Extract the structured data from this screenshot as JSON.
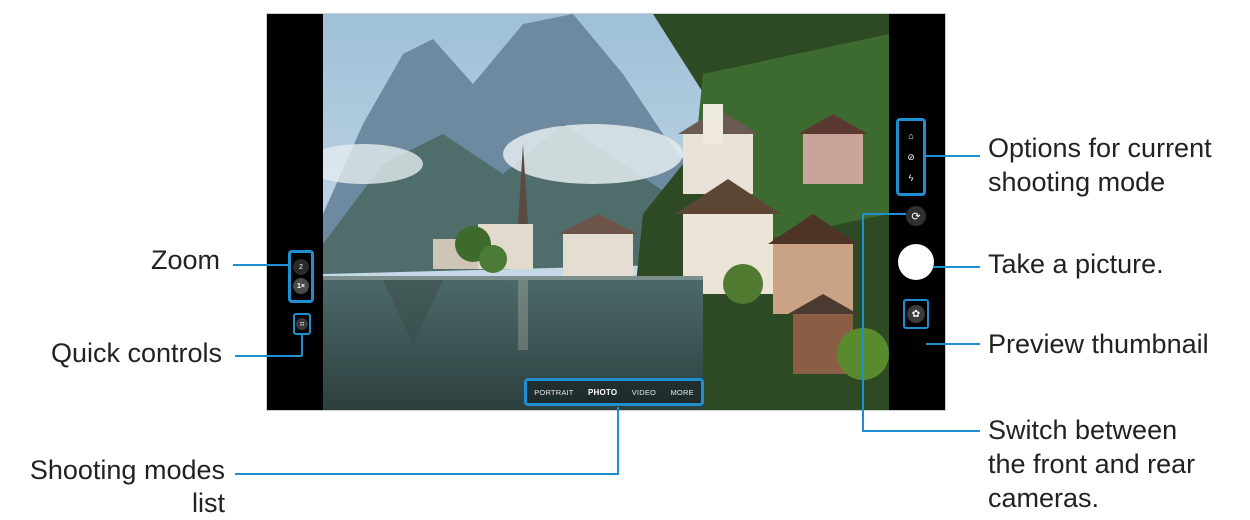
{
  "camera": {
    "zoom_levels": [
      "2",
      "1×"
    ],
    "active_zoom": "1×",
    "quick_controls_icon": "grid-dots-icon",
    "option_icons": [
      "camera-aspect-icon",
      "timer-off-icon",
      "flash-icon"
    ],
    "switch_icon": "rotate-camera-icon",
    "preview_icon": "flower-thumbnail-icon",
    "modes": [
      "PORTRAIT",
      "PHOTO",
      "VIDEO",
      "MORE"
    ],
    "active_mode": "PHOTO",
    "accent_color": "#1e8fd0"
  },
  "labels": {
    "zoom": "Zoom",
    "quick_controls": "Quick controls",
    "shooting_modes_line1": "Shooting modes",
    "shooting_modes_line2": "list",
    "options_line1": "Options for current",
    "options_line2": "shooting mode",
    "take_picture": "Take a picture.",
    "preview": "Preview thumbnail",
    "switch_line1": "Switch between",
    "switch_line2": "the front and rear",
    "switch_line3": "cameras."
  }
}
